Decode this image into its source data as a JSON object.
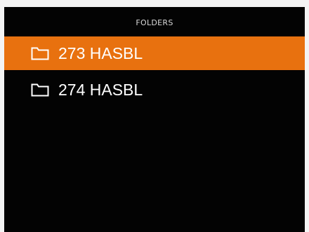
{
  "header": {
    "title": "FOLDERS"
  },
  "folders": [
    {
      "label": "273 HASBL",
      "icon": "folder-icon",
      "selected": true
    },
    {
      "label": "274 HASBL",
      "icon": "folder-icon",
      "selected": false
    }
  ],
  "colors": {
    "background": "#030303",
    "selected": "#e8710f",
    "text": "#ffffff",
    "header_text": "#d9d9d9"
  }
}
